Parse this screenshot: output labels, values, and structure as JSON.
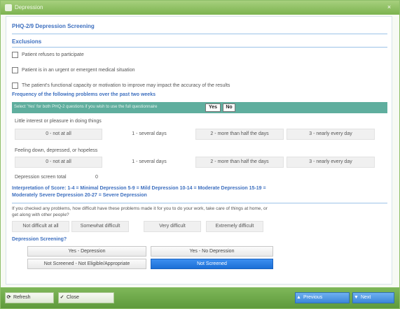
{
  "window": {
    "title": "Depression",
    "close_glyph": "×"
  },
  "form": {
    "title": "PHQ-2/9 Depression Screening",
    "exclusions": {
      "heading": "Exclusions",
      "items": [
        {
          "label": "Patient refuses to participate",
          "checked": false
        },
        {
          "label": "Patient is in an urgent or emergent medical situation",
          "checked": false
        },
        {
          "label": "The patient's functional capacity or motivation to improve may impact the accuracy of the results",
          "checked": false
        }
      ]
    },
    "frequency": {
      "heading": "Frequency of the following problems over the past two weeks",
      "select_all_text": "Select 'Yes' for both PHQ-2 questions if you wish to use the full questionnaire",
      "yes_label": "Yes",
      "no_label": "No"
    },
    "questions": [
      {
        "label": "Little interest or pleasure in doing things",
        "options": [
          "0 - not at all",
          "1 - several days",
          "2 - more than half the days",
          "3 - nearly every day"
        ]
      },
      {
        "label": "Feeling down, depressed, or hopeless",
        "options": [
          "0 - not at all",
          "1 - several days",
          "2 - more than half the days",
          "3 - nearly every day"
        ]
      }
    ],
    "total": {
      "label": "Depression screen total",
      "value": "0"
    },
    "interpretation": {
      "line1": "Interpretation of Score: 1-4 = Minimal Depression 5-9 = Mild Depression 10-14 = Moderate Depression 15-19 =",
      "line2": "Moderately Severe Depression 20-27 = Severe Depression"
    },
    "difficulty": {
      "question_line1": "If you checked any problems, how difficult have these problems made it for you to do your work, take care of things at home, or",
      "question_line2": "get along with other people?",
      "options": [
        "Not difficult at all",
        "Somewhat difficult",
        "Very difficult",
        "Extremely difficult"
      ]
    },
    "screening": {
      "heading": "Depression Screening?",
      "options": {
        "yes_depression": "Yes - Depression",
        "yes_no_depression": "Yes - No Depression",
        "not_screened_eligible": "Not Screened - Not Eligible/Appropriate",
        "not_screened": "Not Screened"
      },
      "selected": "Not Screened"
    }
  },
  "footer": {
    "refresh_label": "Refresh",
    "close_label": "Close",
    "previous_label": "Previous",
    "next_label": "Next"
  },
  "colors": {
    "title_green": "#7cb34f",
    "heading_blue": "#3d6fbf",
    "teal_bar": "#5fae9e",
    "selected_blue": "#1b6fd6"
  }
}
